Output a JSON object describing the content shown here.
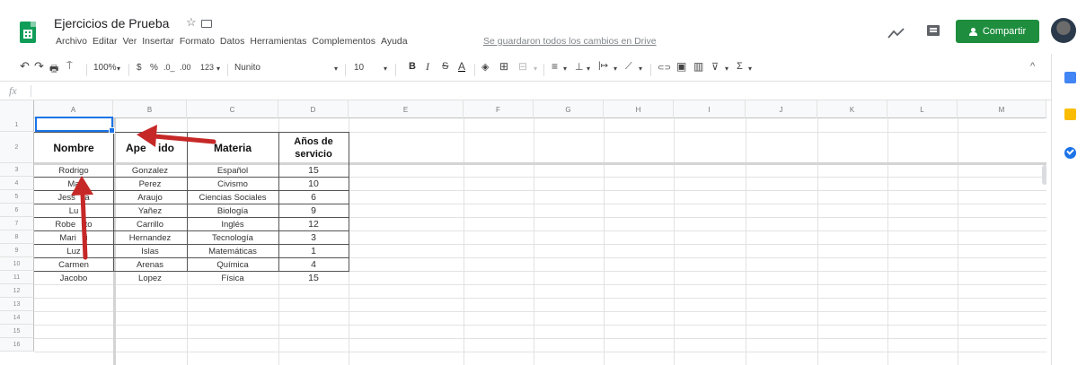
{
  "header": {
    "doc_title": "Ejercicios de Prueba",
    "star_glyph": "☆",
    "menu": [
      "Archivo",
      "Editar",
      "Ver",
      "Insertar",
      "Formato",
      "Datos",
      "Herramientas",
      "Complementos",
      "Ayuda"
    ],
    "save_status": "Se guardaron todos los cambios en Drive",
    "share_label": "Compartir",
    "share_color": "#1e8e3e"
  },
  "toolbar": {
    "undo": "↶",
    "redo": "↷",
    "print": "🖶",
    "paint": "⍑",
    "zoom": "100%",
    "zoom_caret": "▾",
    "currency": "$",
    "percent": "%",
    "dec_less": ".0_",
    "dec_more": ".00",
    "format_more": "123",
    "format_caret": "▾",
    "font": "Nunito",
    "font_caret": "▾",
    "font_size": "10",
    "size_caret": "▾",
    "bold": "B",
    "italic": "I",
    "strike": "S",
    "text_color": "A",
    "fill": "◈",
    "borders": "⊞",
    "merge": "⊟",
    "merge_caret": "▾",
    "halign": "≡",
    "halign_caret": "▾",
    "valign": "⊥",
    "valign_caret": "▾",
    "wrap": "|↦",
    "wrap_caret": "▾",
    "rotate": "⟋",
    "rotate_caret": "▾",
    "link": "⊂⊃",
    "comment": "▣",
    "chart": "▥",
    "filter": "⊽",
    "filter_caret": "▾",
    "functions": "Σ",
    "functions_caret": "▾",
    "collapse": "^"
  },
  "formula_bar": {
    "fx": "fx"
  },
  "columns": [
    "A",
    "B",
    "C",
    "D",
    "E",
    "F",
    "G",
    "H",
    "I",
    "J",
    "K",
    "L",
    "M"
  ],
  "rows": [
    "1",
    "2",
    "3",
    "4",
    "5",
    "6",
    "7",
    "8",
    "9",
    "10",
    "11",
    "12",
    "13",
    "14",
    "15",
    "16"
  ],
  "table": {
    "headers": [
      "Nombre",
      "Ape    ido",
      "Materia",
      "Años de",
      "servicio"
    ],
    "rows": [
      [
        "Rodrigo",
        "Gonzalez",
        "Español",
        "15"
      ],
      [
        "Ma",
        "Perez",
        "Civismo",
        "10"
      ],
      [
        "Jess    a",
        "Araujo",
        "Ciencias Sociales",
        "6"
      ],
      [
        "Lu",
        "Yañez",
        "Biología",
        "9"
      ],
      [
        "Robe    to",
        "Carrillo",
        "Inglés",
        "12"
      ],
      [
        "Mari    i",
        "Hernandez",
        "Tecnología",
        "3"
      ],
      [
        "Luz",
        "Islas",
        "Matemáticas",
        "1"
      ],
      [
        "Carmen",
        "Arenas",
        "Química",
        "4"
      ],
      [
        "Jacobo",
        "Lopez",
        "Física",
        "15"
      ]
    ]
  },
  "annotation_color": "#c62828"
}
